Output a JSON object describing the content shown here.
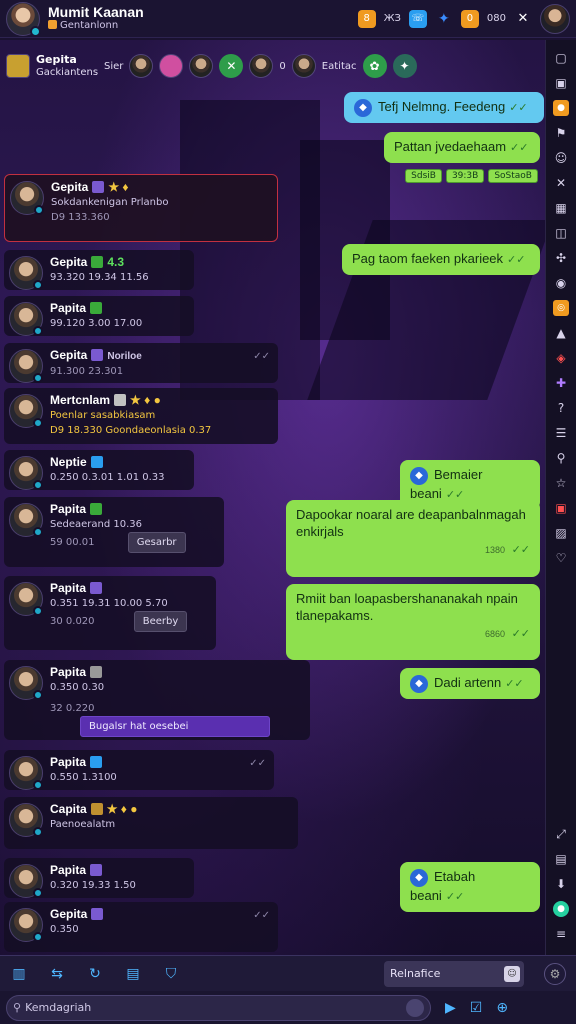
{
  "header": {
    "title": "Mumit Kaanan",
    "subtitle": "Gentanlonn",
    "badge1": "8",
    "badge_text": "ЖЗ",
    "badge2": "0",
    "count": "080",
    "colors": {
      "accent": "#8ee04e",
      "bg": "#1b1432"
    }
  },
  "strip": {
    "name": "Gepita",
    "sub": "Gackiantens",
    "lbl1": "Sier",
    "lbl2": "0",
    "lbl3": "Eatitac"
  },
  "cards": [
    {
      "name": "Gepita",
      "sub": "Sokdankenigan Prlanbo",
      "meta": "D9  133.360"
    },
    {
      "name": "Gepita",
      "sub": "93.320   19.34   11.56",
      "meta": ""
    },
    {
      "name": "Papita",
      "sub": "99.120   3.00   17.00",
      "meta": ""
    },
    {
      "name": "Gepita",
      "sub": "Noriloe",
      "meta": "91.300   23.301"
    },
    {
      "name": "Mertcnlam",
      "sub": "Poenlar sasabkiasam",
      "meta": "D9  18.330   Goondaeonlasia   0.37"
    },
    {
      "name": "Neptie",
      "sub": "0.250   0.3.01   1.01   0.33",
      "meta": ""
    },
    {
      "name": "Papita",
      "sub": "Sedeaerand   10.36",
      "meta": "59  00.01",
      "chip": "Gesarbr"
    },
    {
      "name": "Papita",
      "sub": "0.351   19.31   10.00   5.70",
      "meta": "30  0.020",
      "chip": "Beerby"
    },
    {
      "name": "Papita",
      "sub": "0.350   0.30",
      "meta": "32  0.220",
      "chip": "Bugalsr hat oesebei"
    },
    {
      "name": "Papita",
      "sub": "0.550   1.3100",
      "meta": ""
    },
    {
      "name": "Capita",
      "sub": "Paenoealatm",
      "meta": ""
    },
    {
      "name": "Papita",
      "sub": "0.320   19.33   1.50",
      "meta": ""
    },
    {
      "name": "Gepita",
      "sub": "0.350",
      "meta": ""
    }
  ],
  "bubbles": [
    {
      "text": "Tefj Nelmng. Feedeng",
      "type": "blue"
    },
    {
      "text": "Pattan jvedaehaam"
    },
    {
      "text": "Pag taom faeken pkarieek"
    },
    {
      "text": "Bemaier beani"
    },
    {
      "text": "Dapookar noaral are deapanbalnmagah enkirjals",
      "time": "1380"
    },
    {
      "text": "Rmiit ban loapasbershananakah npain tlanepakams.",
      "time": "6860"
    },
    {
      "text": "Dadi artenn"
    },
    {
      "text": "Etabah beani"
    }
  ],
  "tags": [
    "SdsiB",
    "39:3B",
    "SoStaoB"
  ],
  "toolbar": {
    "rel_label": "Relnafice"
  },
  "search": {
    "placeholder": "Kemdagriah"
  }
}
